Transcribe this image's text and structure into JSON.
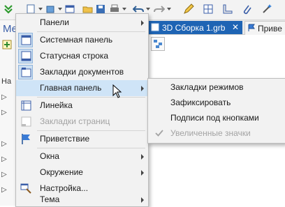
{
  "toolbar": {
    "icons": [
      "double-chevron-down-icon",
      "new-document-icon",
      "box-icon",
      "window-icon",
      "folder-open-icon",
      "save-icon",
      "print-icon",
      "undo-icon",
      "redo-icon",
      "pencil-icon",
      "grid-icon",
      "ruler-icon",
      "paperclip-icon",
      "magic-icon"
    ]
  },
  "left_panel": {
    "letter": "Ме",
    "tree_label": "На"
  },
  "tabs": [
    {
      "label": "3D Сборка 1.grb",
      "close": "✕",
      "active": true
    },
    {
      "label": "Приве",
      "active": false
    }
  ],
  "main_menu": {
    "items": [
      {
        "label": "Панели",
        "submenu": true
      },
      {
        "label": "Системная панель",
        "checked": true
      },
      {
        "label": "Статусная строка",
        "checked": true
      },
      {
        "label": "Закладки документов",
        "checked": true
      },
      {
        "label": "Главная панель",
        "submenu": true,
        "highlighted": true
      },
      {
        "label": "Линейка"
      },
      {
        "label": "Закладки страниц",
        "disabled": true
      },
      {
        "label": "Приветствие"
      },
      {
        "label": "Окна",
        "submenu": true
      },
      {
        "label": "Окружение",
        "submenu": true
      },
      {
        "label": "Настройка..."
      },
      {
        "label": "Тема",
        "submenu": true
      }
    ]
  },
  "sub_menu": {
    "items": [
      {
        "label": "Закладки режимов"
      },
      {
        "label": "Зафиксировать"
      },
      {
        "label": "Подписи под кнопками"
      },
      {
        "label": "Увеличенные значки",
        "disabled": true,
        "checked": true
      }
    ]
  },
  "colors": {
    "accent": "#1e64b4",
    "highlight": "#cfe4f7",
    "menu_bg": "#f2f2f2",
    "disabled": "#a3a3a3"
  }
}
